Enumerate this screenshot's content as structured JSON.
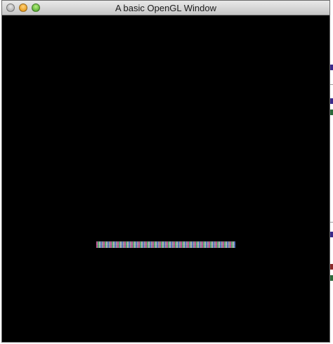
{
  "window": {
    "title": "A basic OpenGL Window"
  },
  "icons": {
    "close": "close-button",
    "minimize": "minimize-button",
    "zoom": "zoom-button"
  },
  "colors": {
    "canvas": "#000000",
    "titlebar_top": "#e9e9e9",
    "titlebar_bottom": "#c6c6c6",
    "close": "#a0a0a0",
    "minimize": "#e08a00",
    "zoom": "#3b9a1c"
  }
}
